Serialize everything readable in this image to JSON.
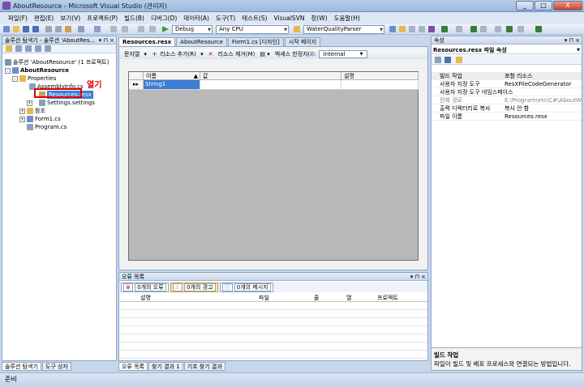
{
  "window": {
    "title": "AboutResource - Microsoft Visual Studio (관리자)",
    "min": "_",
    "max": "□",
    "close": "X"
  },
  "menu": [
    "파일(F)",
    "편집(E)",
    "보기(V)",
    "프로젝트(P)",
    "빌드(B)",
    "디버그(D)",
    "데이터(A)",
    "도구(T)",
    "테스트(S)",
    "VisualSVN",
    "창(W)",
    "도움말(H)"
  ],
  "toolbar": {
    "config": "Debug",
    "platform": "Any CPU",
    "project": "WaterQualityParser"
  },
  "solution_explorer": {
    "title": "솔루션 탐색기 - 솔루션 'AboutRes...",
    "items": [
      {
        "label": "솔루션 'AboutResource' (1 프로젝트)"
      },
      {
        "label": "AboutResource"
      },
      {
        "label": "Properties"
      },
      {
        "label": "AssemblyInfo.cs"
      },
      {
        "label": "Resources.resx"
      },
      {
        "label": "Settings.settings"
      },
      {
        "label": "참조"
      },
      {
        "label": "Form1.cs"
      },
      {
        "label": "Program.cs"
      }
    ],
    "annotation": "열기",
    "tabs": [
      "솔루션 탐색기",
      "도구 상자"
    ]
  },
  "doc_tabs": [
    "Resources.resx",
    "AboutResource",
    "Form1.cs [디자인]",
    "시작 페이지"
  ],
  "editor": {
    "toolbar": {
      "strings": "문자열",
      "add": "리소스 추가(R)",
      "remove": "리소스 제거(M)",
      "access_label": "액세스 한정자(I):",
      "access_value": "Internal"
    },
    "columns": [
      "이름",
      "값",
      "설명"
    ],
    "row_marker": "▸▸",
    "rows": [
      {
        "name": "String1",
        "value": "",
        "comment": ""
      }
    ]
  },
  "error_list": {
    "title": "오류 목록",
    "buttons": [
      "0개의 오류",
      "0개의 경고",
      "0개의 메시지"
    ],
    "columns": [
      "설명",
      "파일",
      "줄",
      "열",
      "프로젝트"
    ]
  },
  "bottom_tabs": [
    "오류 목록",
    "찾기 결과 1",
    "기호 찾기 결과"
  ],
  "properties": {
    "title": "속성",
    "object": "Resources.resx 파일 속성",
    "rows": [
      {
        "name": "빌드 작업",
        "value": "포함 리소스",
        "gray": false
      },
      {
        "name": "사용자 지정 도구",
        "value": "ResXFileCodeGenerator",
        "gray": false
      },
      {
        "name": "사용자 지정 도구 네임스페이스",
        "value": "",
        "gray": false
      },
      {
        "name": "전체 경로",
        "value": "E:\\Program\\etc\\C#\\AboutW",
        "gray": true
      },
      {
        "name": "출력 디렉터리로 복사",
        "value": "복사 안 함",
        "gray": false
      },
      {
        "name": "파일 이름",
        "value": "Resources.resx",
        "gray": false
      }
    ],
    "desc_title": "빌드 작업",
    "desc_text": "파일이 빌드 및 배포 프로세스와 연결되는 방법입니다."
  },
  "status": "준비"
}
